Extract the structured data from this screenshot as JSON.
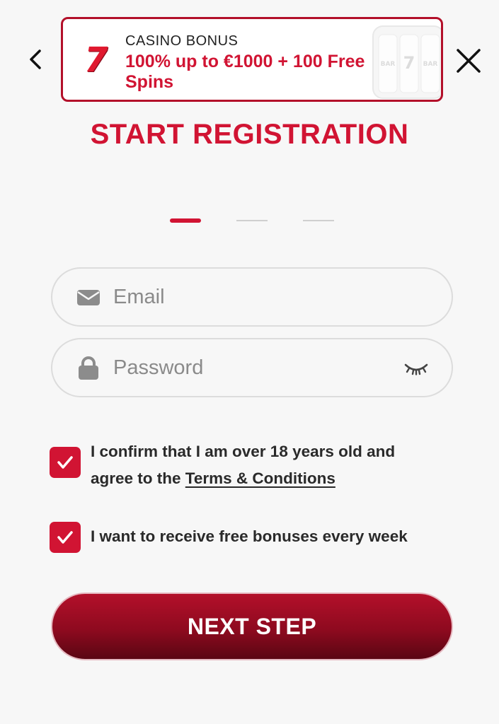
{
  "banner": {
    "label": "CASINO BONUS",
    "offer": "100% up to €1000 + 100 Free Spins",
    "seven": "7",
    "slot_reel_symbols": [
      "BAR",
      "7",
      "BAR"
    ]
  },
  "title": "START REGISTRATION",
  "steps": {
    "total": 3,
    "current": 1
  },
  "form": {
    "email": {
      "value": "",
      "placeholder": "Email",
      "icon": "envelope-icon"
    },
    "password": {
      "value": "",
      "placeholder": "Password",
      "icon": "lock-icon",
      "toggle_icon": "eye-closed-icon"
    }
  },
  "consents": {
    "age_text": "I confirm that I am over 18 years old and agree to the ",
    "terms_link": "Terms & Conditions",
    "age_checked": true,
    "bonus_text": "I want to receive free bonuses every week",
    "bonus_checked": true
  },
  "next_button": "NEXT STEP",
  "colors": {
    "brand_red": "#d11433",
    "button_dark": "#5a0613",
    "field_border": "#dcdcdc"
  }
}
